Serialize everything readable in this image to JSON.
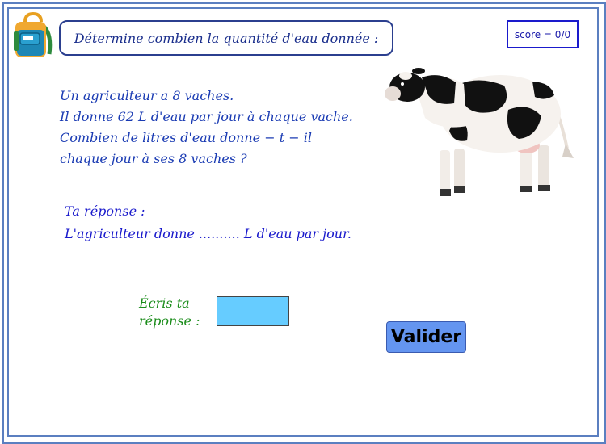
{
  "title": "Détermine combien la quantité d'eau donnée :",
  "score": "score = 0/0",
  "problem": {
    "lines": [
      "Un agriculteur a 8 vaches.",
      "Il donne 62 L d'eau par jour à chaque vache.",
      "Combien de litres d'eau donne − t − il",
      "chaque jour à ses 8 vaches ?"
    ]
  },
  "answer": {
    "label": "Ta réponse :",
    "sentence": "L'agriculteur donne .......... L d'eau par jour."
  },
  "prompt": {
    "line1": "Écris ta",
    "line2": "réponse :"
  },
  "input": {
    "value": ""
  },
  "validate_button": "Valider",
  "colors": {
    "frame": "#5b7fc0",
    "title": "#1a2e8c",
    "problem_text": "#1a3bb3",
    "answer_text": "#1a1acc",
    "prompt_text": "#1a8c1a",
    "input_bg": "#66ccff",
    "button_bg": "#6495f0"
  },
  "icons": {
    "backpack": "backpack-icon",
    "cow": "cow-image"
  }
}
